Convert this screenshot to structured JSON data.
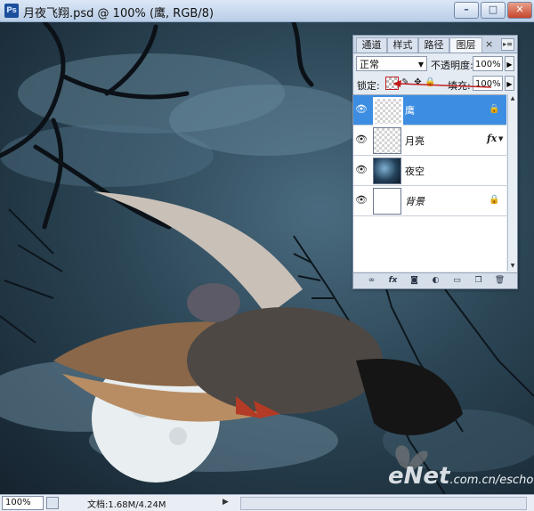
{
  "window": {
    "app_icon_text": "Ps",
    "title": "月夜飞翔.psd @ 100% (鹰, RGB/8)",
    "min_glyph": "–",
    "max_glyph": "□",
    "close_glyph": "✕"
  },
  "status_bar": {
    "zoom": "100%",
    "doc_info": "文档:1.68M/4.24M",
    "arrow": "▶"
  },
  "layers_panel": {
    "tabs": [
      {
        "label": "通道",
        "active": false
      },
      {
        "label": "样式",
        "active": false
      },
      {
        "label": "路径",
        "active": false
      },
      {
        "label": "图层",
        "active": true
      }
    ],
    "close_glyph": "×",
    "menu_glyph": "▸≡",
    "blend_mode": "正常",
    "opacity_label": "不透明度:",
    "opacity_value": "100%",
    "lock_label": "锁定:",
    "fill_label": "填充:",
    "fill_value": "100%",
    "layers": [
      {
        "name": "鹰",
        "selected": true,
        "thumb": "bird",
        "locked_partial": true
      },
      {
        "name": "月亮",
        "selected": false,
        "thumb": "moon",
        "fx": "fx"
      },
      {
        "name": "夜空",
        "selected": false,
        "thumb": "sky"
      },
      {
        "name": "背景",
        "selected": false,
        "thumb": "bg",
        "locked": true
      }
    ],
    "bottom_icons": [
      "link-icon",
      "fx-icon",
      "mask-icon",
      "adjustment-icon",
      "group-icon",
      "new-layer-icon",
      "trash-icon"
    ]
  },
  "watermark": {
    "logo": "eNet",
    "url": ".com.cn/eschool"
  },
  "colors": {
    "selection": "#3d8ee3",
    "highlight_red": "#c21d1d"
  }
}
